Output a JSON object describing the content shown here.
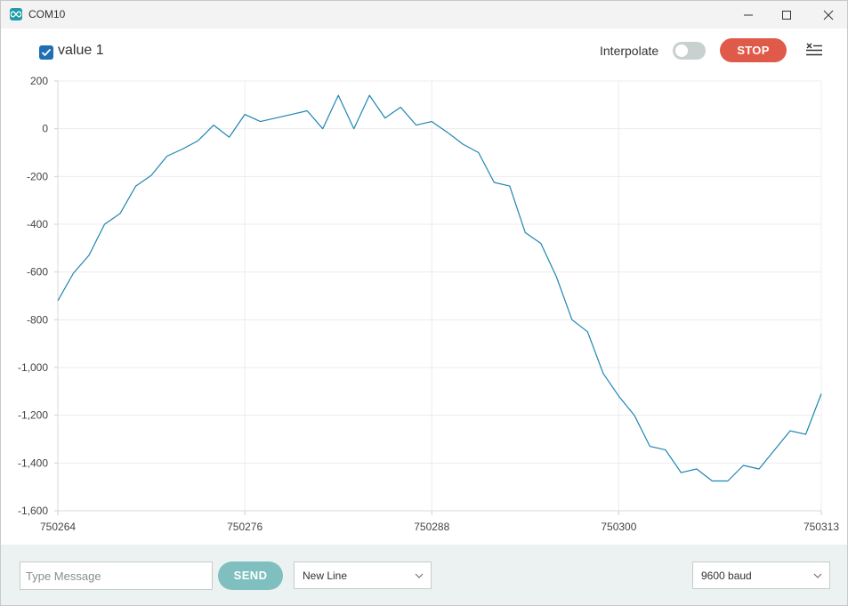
{
  "window": {
    "title": "COM10",
    "app_icon": "arduino-infinity-icon"
  },
  "toolbar": {
    "series_label": "value 1",
    "series_checked": true,
    "series_color": "#1f85b3",
    "interpolate_label": "Interpolate",
    "interpolate_on": false,
    "stop_label": "STOP",
    "stop_color": "#e05a4a",
    "clear_icon": "clear-list-icon"
  },
  "chart_data": {
    "type": "line",
    "series": [
      {
        "name": "value 1",
        "color": "#1f85b3",
        "x": [
          750264,
          750265,
          750266,
          750267,
          750268,
          750269,
          750270,
          750271,
          750272,
          750273,
          750274,
          750275,
          750276,
          750277,
          750278,
          750279,
          750280,
          750281,
          750282,
          750283,
          750284,
          750285,
          750286,
          750287,
          750288,
          750289,
          750290,
          750291,
          750292,
          750293,
          750294,
          750295,
          750296,
          750297,
          750298,
          750299,
          750300,
          750301,
          750302,
          750303,
          750304,
          750305,
          750306,
          750307,
          750308,
          750309,
          750310,
          750311,
          750312,
          750313
        ],
        "values": [
          -720,
          -605,
          -530,
          -400,
          -355,
          -240,
          -195,
          -115,
          -85,
          -50,
          15,
          -35,
          60,
          30,
          45,
          60,
          75,
          0,
          140,
          0,
          140,
          45,
          90,
          15,
          30,
          -15,
          -65,
          -100,
          -225,
          -240,
          -435,
          -480,
          -620,
          -800,
          -850,
          -1025,
          -1120,
          -1200,
          -1330,
          -1345,
          -1440,
          -1425,
          -1475,
          -1475,
          -1410,
          -1425,
          -1345,
          -1265,
          -1280,
          -1110
        ]
      }
    ],
    "xlim": [
      750264,
      750313
    ],
    "ylim": [
      -1600,
      200
    ],
    "x_ticks": [
      750264,
      750276,
      750288,
      750300,
      750313
    ],
    "y_ticks": [
      200,
      0,
      -200,
      -400,
      -600,
      -800,
      -1000,
      -1200,
      -1400,
      -1600
    ],
    "x_tick_labels": [
      "750264",
      "750276",
      "750288",
      "750300",
      "750313"
    ],
    "y_tick_labels": [
      "200",
      "0",
      "-200",
      "-400",
      "-600",
      "-800",
      "-1,000",
      "-1,200",
      "-1,400",
      "-1,600"
    ],
    "grid": true
  },
  "footer": {
    "message_placeholder": "Type Message",
    "message_value": "",
    "send_label": "SEND",
    "line_ending": "New Line",
    "baud_rate": "9600 baud"
  }
}
